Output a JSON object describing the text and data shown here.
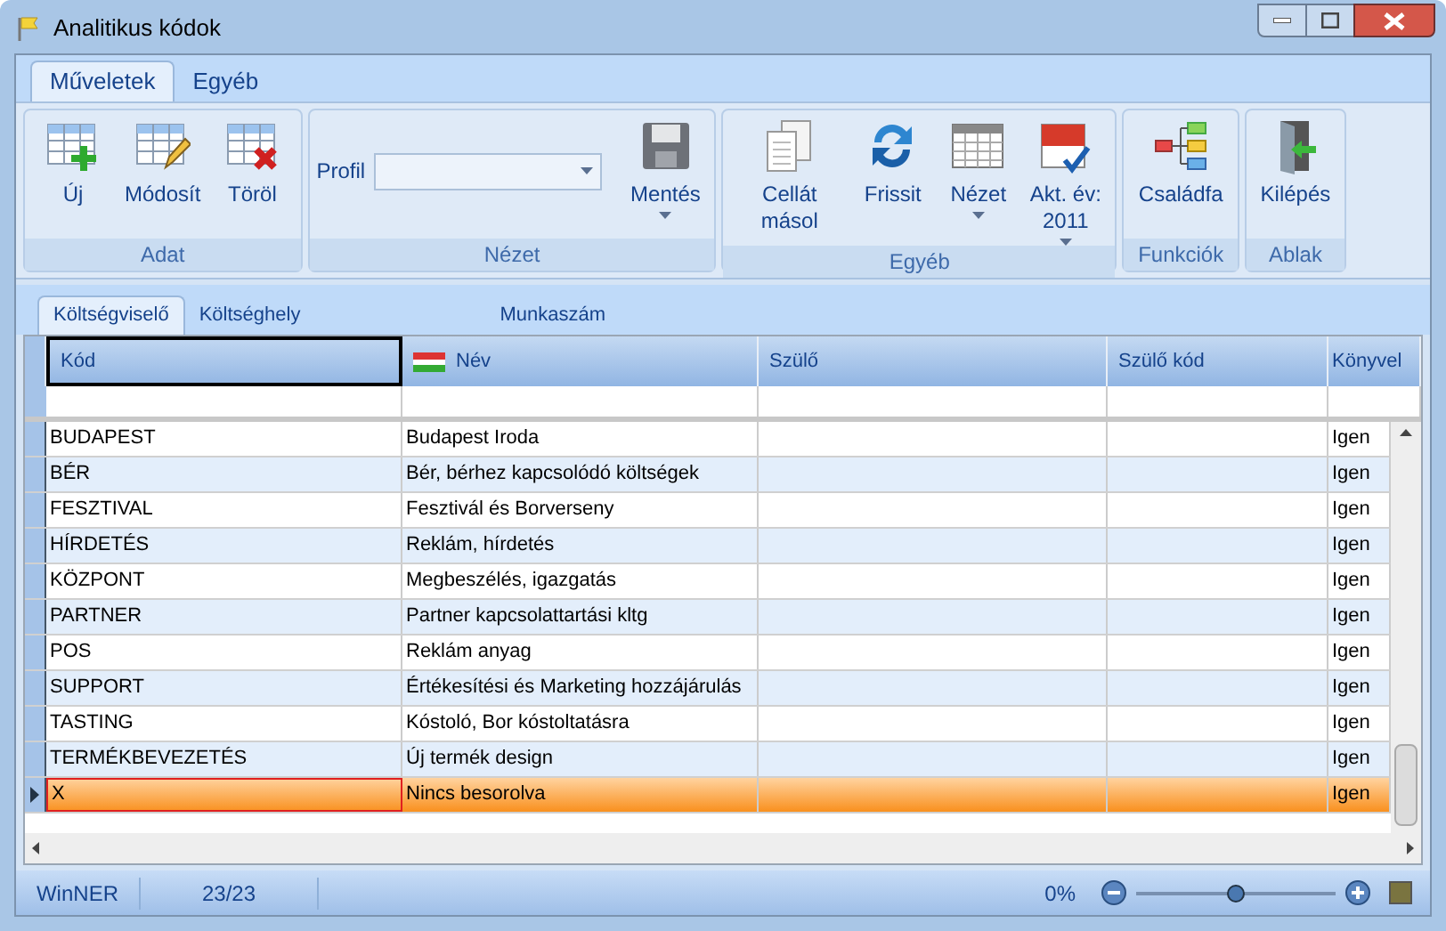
{
  "window": {
    "title": "Analitikus kódok"
  },
  "ribbon_tabs": [
    {
      "label": "Műveletek",
      "selected": true
    },
    {
      "label": "Egyéb",
      "selected": false
    }
  ],
  "ribbon_groups": [
    {
      "label": "Adat",
      "items": [
        {
          "kind": "button",
          "label": "Új",
          "dropdown": false
        },
        {
          "kind": "button",
          "label": "Módosít",
          "dropdown": false
        },
        {
          "kind": "button",
          "label": "Töröl",
          "dropdown": false
        }
      ]
    },
    {
      "label": "Nézet",
      "items": [
        {
          "kind": "combo",
          "label": "Profil"
        },
        {
          "kind": "button",
          "label": "Mentés",
          "dropdown": true
        }
      ]
    },
    {
      "label": "Egyéb",
      "items": [
        {
          "kind": "button",
          "label": "Cellát másol",
          "dropdown": false
        },
        {
          "kind": "button",
          "label": "Frissit",
          "dropdown": false
        },
        {
          "kind": "button",
          "label": "Nézet",
          "dropdown": true
        },
        {
          "kind": "button",
          "label": "Akt. év: 2011",
          "dropdown": true
        }
      ]
    },
    {
      "label": "Funkciók",
      "items": [
        {
          "kind": "button",
          "label": "Családfa",
          "dropdown": false
        }
      ]
    },
    {
      "label": "Ablak",
      "items": [
        {
          "kind": "button",
          "label": "Kilépés",
          "dropdown": false
        }
      ]
    }
  ],
  "doc_tabs": [
    {
      "label": "Költségviselő",
      "selected": true
    },
    {
      "label": "Költséghely",
      "selected": false
    },
    {
      "label": "Munkaszám",
      "selected": false
    }
  ],
  "table": {
    "columns": [
      "Kód",
      "Név",
      "Szülő",
      "Szülő kód",
      "Könyvel"
    ],
    "rows": [
      {
        "cells": [
          "BUDAPEST",
          "Budapest Iroda",
          "",
          "",
          "Igen"
        ],
        "selected": false
      },
      {
        "cells": [
          "BÉR",
          "Bér, bérhez kapcsolódó költségek",
          "",
          "",
          "Igen"
        ],
        "selected": false
      },
      {
        "cells": [
          "FESZTIVAL",
          "Fesztivál és Borverseny",
          "",
          "",
          "Igen"
        ],
        "selected": false
      },
      {
        "cells": [
          "HÍRDETÉS",
          "Reklám, hírdetés",
          "",
          "",
          "Igen"
        ],
        "selected": false
      },
      {
        "cells": [
          "KÖZPONT",
          "Megbeszélés, igazgatás",
          "",
          "",
          "Igen"
        ],
        "selected": false
      },
      {
        "cells": [
          "PARTNER",
          "Partner kapcsolattartási kltg",
          "",
          "",
          "Igen"
        ],
        "selected": false
      },
      {
        "cells": [
          "POS",
          "Reklám anyag",
          "",
          "",
          "Igen"
        ],
        "selected": false
      },
      {
        "cells": [
          "SUPPORT",
          "Értékesítési és Marketing hozzájárulás",
          "",
          "",
          "Igen"
        ],
        "selected": false
      },
      {
        "cells": [
          "TASTING",
          "Kóstoló, Bor kóstoltatásra",
          "",
          "",
          "Igen"
        ],
        "selected": false
      },
      {
        "cells": [
          "TERMÉKBEVEZETÉS",
          "Új termék design",
          "",
          "",
          "Igen"
        ],
        "selected": false
      },
      {
        "cells": [
          "X",
          "Nincs besorolva",
          "",
          "",
          "Igen"
        ],
        "selected": true
      }
    ]
  },
  "status_bar": {
    "app": "WinNER",
    "count": "23/23",
    "zoom": "0%",
    "level": 0.5
  }
}
